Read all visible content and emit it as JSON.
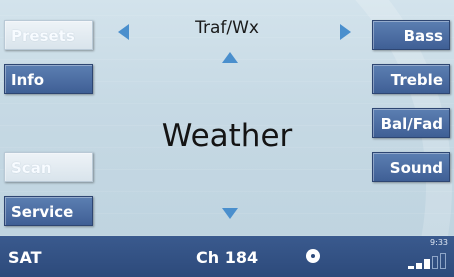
{
  "header": {
    "band_label": "Traf/Wx"
  },
  "main": {
    "title": "Weather"
  },
  "left_buttons": {
    "presets": "Presets",
    "info": "Info",
    "scan": "Scan",
    "service": "Service"
  },
  "right_buttons": {
    "bass": "Bass",
    "treble": "Treble",
    "bal_fad": "Bal/Fad",
    "sound": "Sound"
  },
  "status": {
    "source": "SAT",
    "channel": "Ch 184",
    "time": "9:33",
    "signal_level": 0.5
  },
  "colors": {
    "button_blue": "#4a6aa0",
    "arrow_blue": "#4a8fcd",
    "status_bar": "#2d4a7b",
    "screen_bg": "#c9dbe6"
  }
}
